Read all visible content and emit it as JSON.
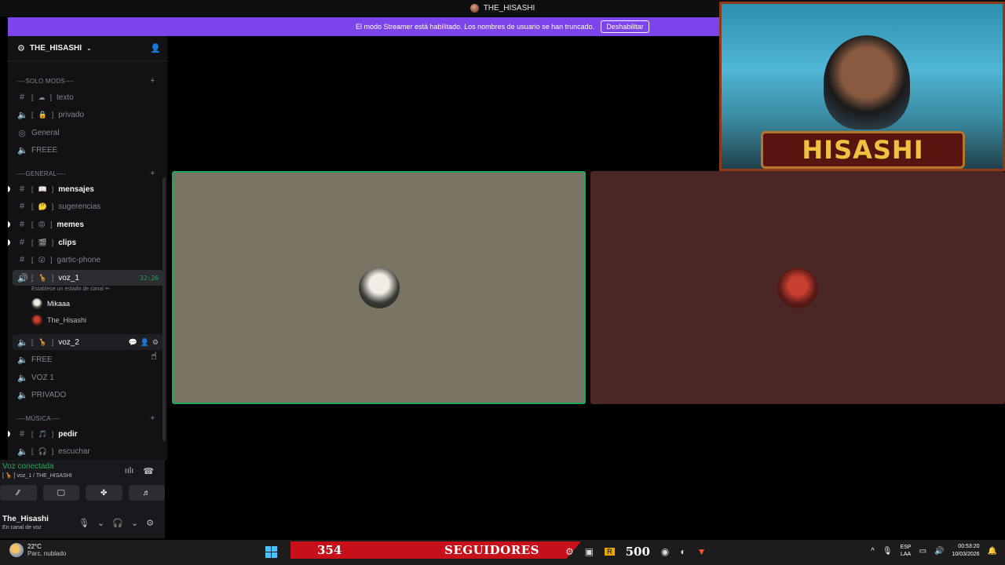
{
  "window": {
    "title": "THE_HISASHI"
  },
  "banner": {
    "text": "El modo Streamer está habilitado. Los nombres de usuario se han truncado.",
    "button": "Deshabilitar"
  },
  "server": {
    "name": "THE_HISASHI"
  },
  "categories": {
    "solo_mods": "----SOLO MODS----",
    "general": "----GENERAL----",
    "musica": "----MÚSICA----"
  },
  "channels": {
    "texto": {
      "name": "texto",
      "emoji": "☁"
    },
    "privado": {
      "name": "privado",
      "emoji": "🔒"
    },
    "general": {
      "name": "General"
    },
    "freee": {
      "name": "FREEE"
    },
    "mensajes": {
      "name": "mensajes",
      "emoji": "📖"
    },
    "sugerencias": {
      "name": "sugerencias",
      "emoji": "🤔"
    },
    "memes": {
      "name": "memes",
      "emoji": "😡"
    },
    "clips": {
      "name": "clips",
      "emoji": "🎬"
    },
    "gartic": {
      "name": "gartic-phone",
      "emoji": "😮"
    },
    "voz1": {
      "name": "voz_1",
      "emoji": "🦒",
      "timer": "32:26",
      "status": "Establece un estado de canal ✏"
    },
    "voz2": {
      "name": "voz_2",
      "emoji": "🦒"
    },
    "free": {
      "name": "FREE"
    },
    "vozone": {
      "name": "VOZ 1"
    },
    "privado2": {
      "name": "PRIVADO"
    },
    "pedir": {
      "name": "pedir",
      "emoji": "🎵"
    },
    "escuchar": {
      "name": "escuchar",
      "emoji": "🎧"
    }
  },
  "members": [
    {
      "name": "Mikaaa"
    },
    {
      "name": "The_Hisashi"
    }
  ],
  "voice": {
    "title": "Voz conectada",
    "sub": "[ 🦒 ] voz_1 / THE_HISASHI"
  },
  "user": {
    "name": "The_Hisashi",
    "status": "En canal de voz"
  },
  "webcam": {
    "plate": "HISASHI"
  },
  "taskbar": {
    "temp": "22°C",
    "weather": "Parc. nublado",
    "followers_count": "354",
    "followers_label": "SEGUIDORES",
    "goal": "500",
    "lang1": "ESP",
    "lang2": "LAA",
    "time": "00:53:20",
    "date": "10/03/2026"
  },
  "colors": {
    "accent": "#7c45ec",
    "voice_green": "#23a55a",
    "tile1": "#7a7464",
    "tile2": "#4a2625"
  }
}
